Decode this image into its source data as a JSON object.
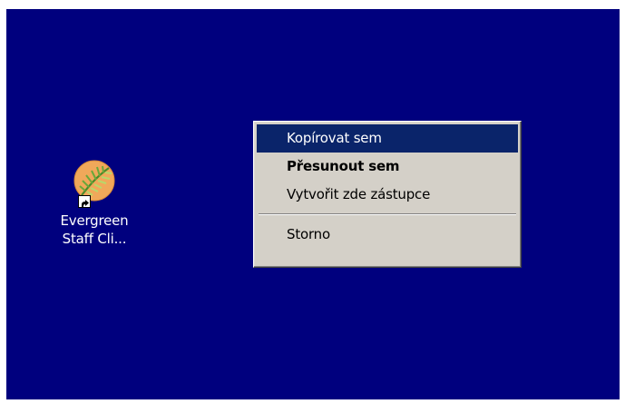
{
  "desktop": {
    "background_color": "#00007e",
    "icon": {
      "icon_name": "evergreen-shortcut-icon",
      "label_line1": "Evergreen",
      "label_line2": "Staff Cli..."
    }
  },
  "context_menu": {
    "items": [
      {
        "label": "Kopírovat sem",
        "state": "highlighted"
      },
      {
        "label": "Přesunout sem",
        "state": "default"
      },
      {
        "label": "Vytvořit zde zástupce",
        "state": "normal"
      },
      {
        "label": "Storno",
        "state": "normal"
      }
    ],
    "highlight_color": "#0a246a",
    "menu_background": "#d4d0c8"
  }
}
